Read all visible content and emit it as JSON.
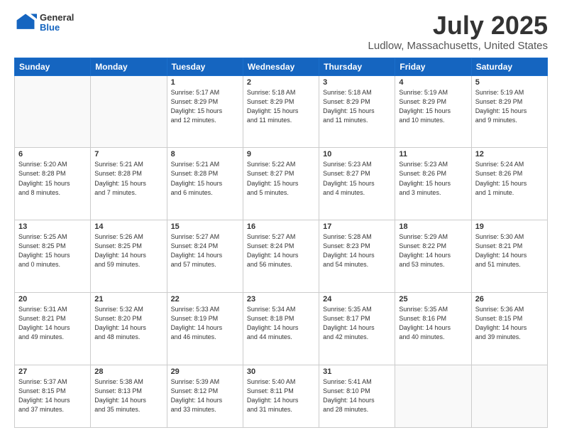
{
  "header": {
    "logo_general": "General",
    "logo_blue": "Blue",
    "title": "July 2025",
    "location": "Ludlow, Massachusetts, United States"
  },
  "days_of_week": [
    "Sunday",
    "Monday",
    "Tuesday",
    "Wednesday",
    "Thursday",
    "Friday",
    "Saturday"
  ],
  "weeks": [
    [
      {
        "day": "",
        "info": ""
      },
      {
        "day": "",
        "info": ""
      },
      {
        "day": "1",
        "info": "Sunrise: 5:17 AM\nSunset: 8:29 PM\nDaylight: 15 hours\nand 12 minutes."
      },
      {
        "day": "2",
        "info": "Sunrise: 5:18 AM\nSunset: 8:29 PM\nDaylight: 15 hours\nand 11 minutes."
      },
      {
        "day": "3",
        "info": "Sunrise: 5:18 AM\nSunset: 8:29 PM\nDaylight: 15 hours\nand 11 minutes."
      },
      {
        "day": "4",
        "info": "Sunrise: 5:19 AM\nSunset: 8:29 PM\nDaylight: 15 hours\nand 10 minutes."
      },
      {
        "day": "5",
        "info": "Sunrise: 5:19 AM\nSunset: 8:29 PM\nDaylight: 15 hours\nand 9 minutes."
      }
    ],
    [
      {
        "day": "6",
        "info": "Sunrise: 5:20 AM\nSunset: 8:28 PM\nDaylight: 15 hours\nand 8 minutes."
      },
      {
        "day": "7",
        "info": "Sunrise: 5:21 AM\nSunset: 8:28 PM\nDaylight: 15 hours\nand 7 minutes."
      },
      {
        "day": "8",
        "info": "Sunrise: 5:21 AM\nSunset: 8:28 PM\nDaylight: 15 hours\nand 6 minutes."
      },
      {
        "day": "9",
        "info": "Sunrise: 5:22 AM\nSunset: 8:27 PM\nDaylight: 15 hours\nand 5 minutes."
      },
      {
        "day": "10",
        "info": "Sunrise: 5:23 AM\nSunset: 8:27 PM\nDaylight: 15 hours\nand 4 minutes."
      },
      {
        "day": "11",
        "info": "Sunrise: 5:23 AM\nSunset: 8:26 PM\nDaylight: 15 hours\nand 3 minutes."
      },
      {
        "day": "12",
        "info": "Sunrise: 5:24 AM\nSunset: 8:26 PM\nDaylight: 15 hours\nand 1 minute."
      }
    ],
    [
      {
        "day": "13",
        "info": "Sunrise: 5:25 AM\nSunset: 8:25 PM\nDaylight: 15 hours\nand 0 minutes."
      },
      {
        "day": "14",
        "info": "Sunrise: 5:26 AM\nSunset: 8:25 PM\nDaylight: 14 hours\nand 59 minutes."
      },
      {
        "day": "15",
        "info": "Sunrise: 5:27 AM\nSunset: 8:24 PM\nDaylight: 14 hours\nand 57 minutes."
      },
      {
        "day": "16",
        "info": "Sunrise: 5:27 AM\nSunset: 8:24 PM\nDaylight: 14 hours\nand 56 minutes."
      },
      {
        "day": "17",
        "info": "Sunrise: 5:28 AM\nSunset: 8:23 PM\nDaylight: 14 hours\nand 54 minutes."
      },
      {
        "day": "18",
        "info": "Sunrise: 5:29 AM\nSunset: 8:22 PM\nDaylight: 14 hours\nand 53 minutes."
      },
      {
        "day": "19",
        "info": "Sunrise: 5:30 AM\nSunset: 8:21 PM\nDaylight: 14 hours\nand 51 minutes."
      }
    ],
    [
      {
        "day": "20",
        "info": "Sunrise: 5:31 AM\nSunset: 8:21 PM\nDaylight: 14 hours\nand 49 minutes."
      },
      {
        "day": "21",
        "info": "Sunrise: 5:32 AM\nSunset: 8:20 PM\nDaylight: 14 hours\nand 48 minutes."
      },
      {
        "day": "22",
        "info": "Sunrise: 5:33 AM\nSunset: 8:19 PM\nDaylight: 14 hours\nand 46 minutes."
      },
      {
        "day": "23",
        "info": "Sunrise: 5:34 AM\nSunset: 8:18 PM\nDaylight: 14 hours\nand 44 minutes."
      },
      {
        "day": "24",
        "info": "Sunrise: 5:35 AM\nSunset: 8:17 PM\nDaylight: 14 hours\nand 42 minutes."
      },
      {
        "day": "25",
        "info": "Sunrise: 5:35 AM\nSunset: 8:16 PM\nDaylight: 14 hours\nand 40 minutes."
      },
      {
        "day": "26",
        "info": "Sunrise: 5:36 AM\nSunset: 8:15 PM\nDaylight: 14 hours\nand 39 minutes."
      }
    ],
    [
      {
        "day": "27",
        "info": "Sunrise: 5:37 AM\nSunset: 8:15 PM\nDaylight: 14 hours\nand 37 minutes."
      },
      {
        "day": "28",
        "info": "Sunrise: 5:38 AM\nSunset: 8:13 PM\nDaylight: 14 hours\nand 35 minutes."
      },
      {
        "day": "29",
        "info": "Sunrise: 5:39 AM\nSunset: 8:12 PM\nDaylight: 14 hours\nand 33 minutes."
      },
      {
        "day": "30",
        "info": "Sunrise: 5:40 AM\nSunset: 8:11 PM\nDaylight: 14 hours\nand 31 minutes."
      },
      {
        "day": "31",
        "info": "Sunrise: 5:41 AM\nSunset: 8:10 PM\nDaylight: 14 hours\nand 28 minutes."
      },
      {
        "day": "",
        "info": ""
      },
      {
        "day": "",
        "info": ""
      }
    ]
  ]
}
